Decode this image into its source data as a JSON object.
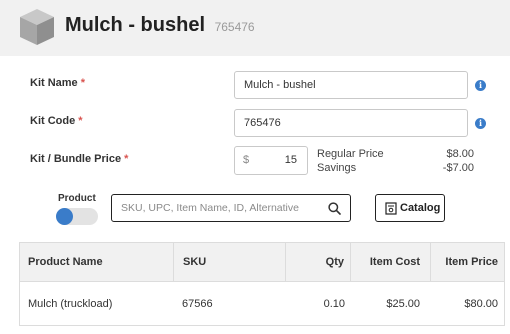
{
  "header": {
    "title": "Mulch - bushel",
    "code": "765476",
    "icon": "box-icon"
  },
  "form": {
    "kit_name_label": "Kit Name",
    "kit_name_value": "Mulch - bushel",
    "kit_code_label": "Kit Code",
    "kit_code_value": "765476",
    "price_label": "Kit / Bundle Price",
    "required_mark": "*",
    "price_currency": "$",
    "price_value": "15",
    "info_icon": "info-icon"
  },
  "summary": {
    "regular_price_label": "Regular Price",
    "regular_price_value": "$8.00",
    "savings_label": "Savings",
    "savings_value": "-$7.00"
  },
  "product_toggle": {
    "label": "Product",
    "on": true
  },
  "search": {
    "placeholder": "SKU, UPC, Item Name, ID, Alternative",
    "icon": "search-icon"
  },
  "catalog_button": {
    "label": "Catalog",
    "icon": "catalog-icon"
  },
  "table": {
    "columns": [
      "Product Name",
      "SKU",
      "Qty",
      "Item Cost",
      "Item Price"
    ],
    "rows": [
      [
        "Mulch (truckload)",
        "67566",
        "0.10",
        "$25.00",
        "$80.00"
      ]
    ]
  },
  "colors": {
    "accent": "#3a7cc9",
    "required": "#d9534f",
    "header_bg": "#f1f1f1"
  }
}
